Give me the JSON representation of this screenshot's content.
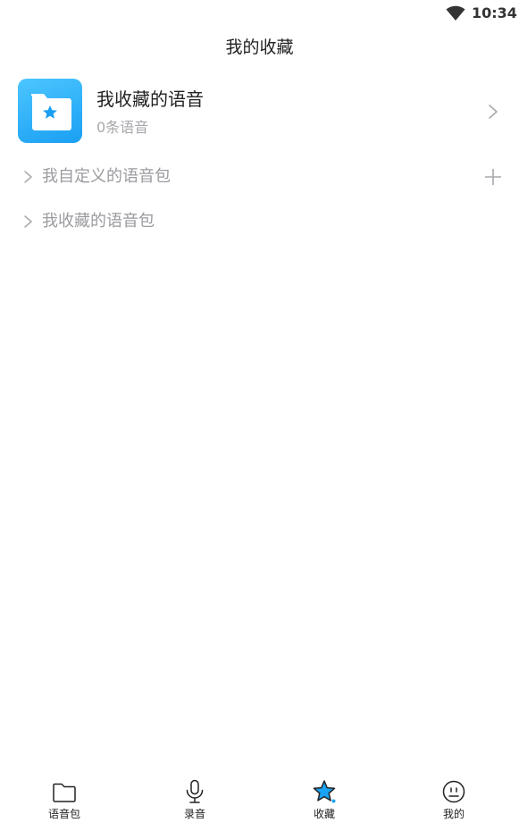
{
  "status_bar": {
    "time": "10:34",
    "wifi_icon": "wifi-icon"
  },
  "header": {
    "title": "我的收藏"
  },
  "favorites_card": {
    "title": "我收藏的语音",
    "count_text": "0条语音",
    "icon": "folder-star-icon",
    "tile_color": "#29aef5"
  },
  "sections": [
    {
      "label": "我自定义的语音包",
      "has_add": true
    },
    {
      "label": "我收藏的语音包",
      "has_add": false
    }
  ],
  "bottom_nav": {
    "items": [
      {
        "label": "语音包",
        "icon": "folder-icon",
        "active": false
      },
      {
        "label": "录音",
        "icon": "microphone-icon",
        "active": false
      },
      {
        "label": "收藏",
        "icon": "star-icon",
        "active": true
      },
      {
        "label": "我的",
        "icon": "smiley-face-icon",
        "active": false
      }
    ],
    "accent_color": "#1aa3f5"
  }
}
